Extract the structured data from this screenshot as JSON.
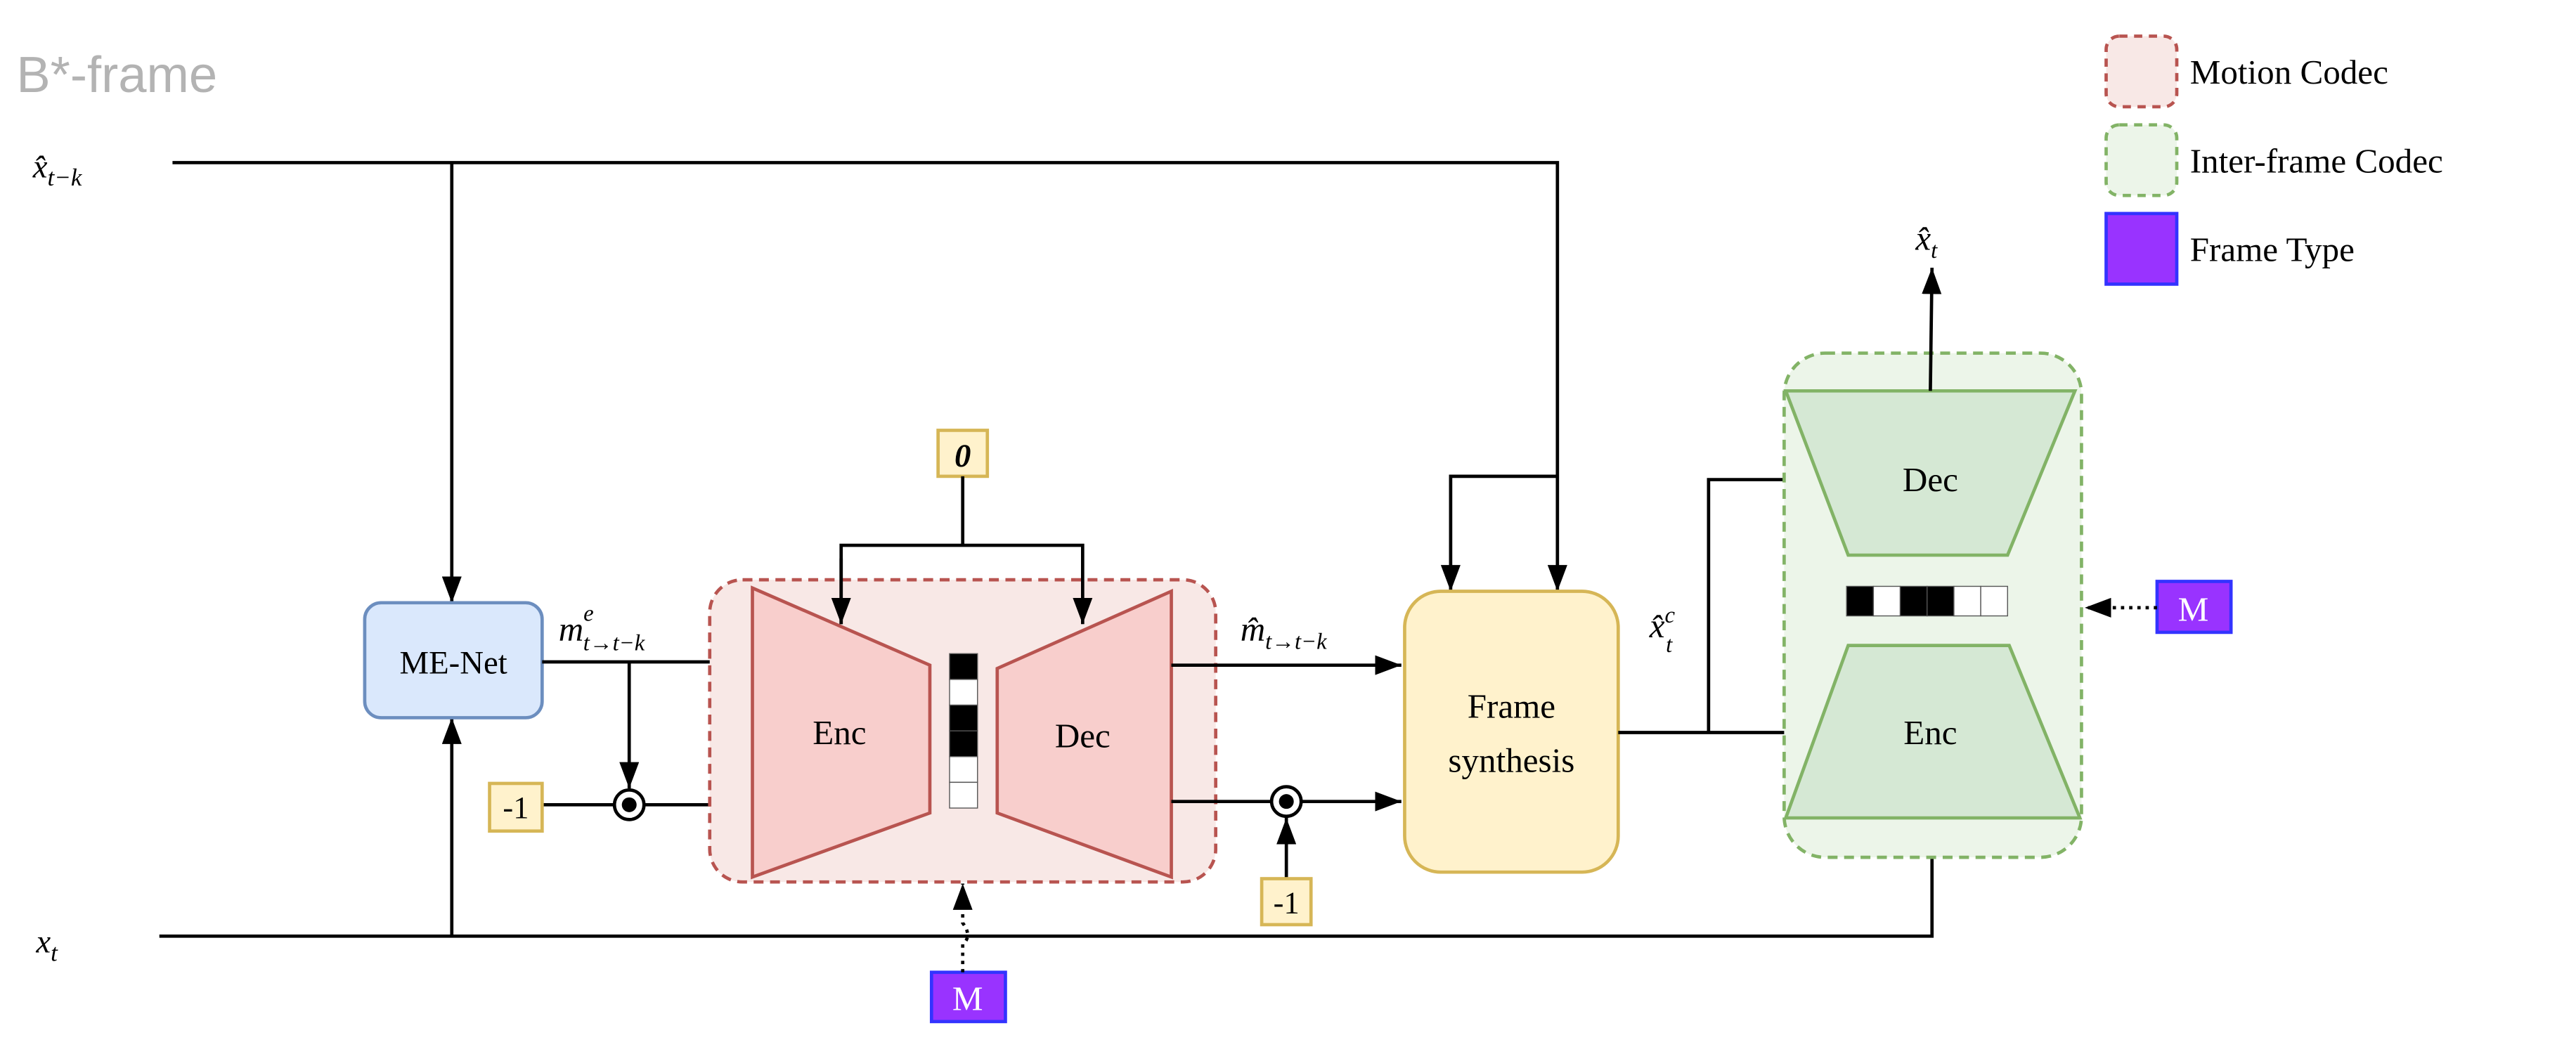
{
  "title": "B*-frame",
  "inputs": {
    "ref_frame": {
      "base": "x̂",
      "sub": "t−k"
    },
    "cur_frame": {
      "base": "x",
      "sub": "t"
    }
  },
  "blocks": {
    "me_net": "ME-Net",
    "motion_enc": "Enc",
    "motion_dec": "Dec",
    "frame_synthesis_line1": "Frame",
    "frame_synthesis_line2": "synthesis",
    "inter_dec": "Dec",
    "inter_enc": "Enc"
  },
  "signals": {
    "motion_est": {
      "base": "m",
      "sup": "e",
      "sub": "t→t−k"
    },
    "motion_rec": {
      "base": "m̂",
      "sub": "t→t−k"
    },
    "coarse": {
      "base": "x̂",
      "sup": "c",
      "sub": "t"
    },
    "output": {
      "base": "x̂",
      "sub": "t"
    }
  },
  "constants": {
    "zero": "0",
    "neg_one_a": "-1",
    "neg_one_b": "-1"
  },
  "mode_labels": {
    "motion": "M",
    "inter": "M"
  },
  "latent_pattern": [
    "black",
    "white",
    "black",
    "black",
    "white",
    "white"
  ],
  "legend": [
    {
      "label": "Motion Codec",
      "fill": "#f8e8e6",
      "stroke": "#b85450",
      "style": "dashed"
    },
    {
      "label": "Inter-frame Codec",
      "fill": "#ecf5e9",
      "stroke": "#82b366",
      "style": "dashed"
    },
    {
      "label": "Frame Type",
      "fill": "#9933ff",
      "stroke": "#3333ff",
      "style": "solid"
    }
  ],
  "colors": {
    "me_net_fill": "#dae8fc",
    "me_net_stroke": "#6c8ebf",
    "motion_fill": "#f8cecc",
    "motion_stroke": "#b85450",
    "inter_fill": "#d5e8d4",
    "inter_stroke": "#82b366",
    "synth_fill": "#fff2cc",
    "synth_stroke": "#d6b656",
    "mode_fill": "#9933ff"
  }
}
